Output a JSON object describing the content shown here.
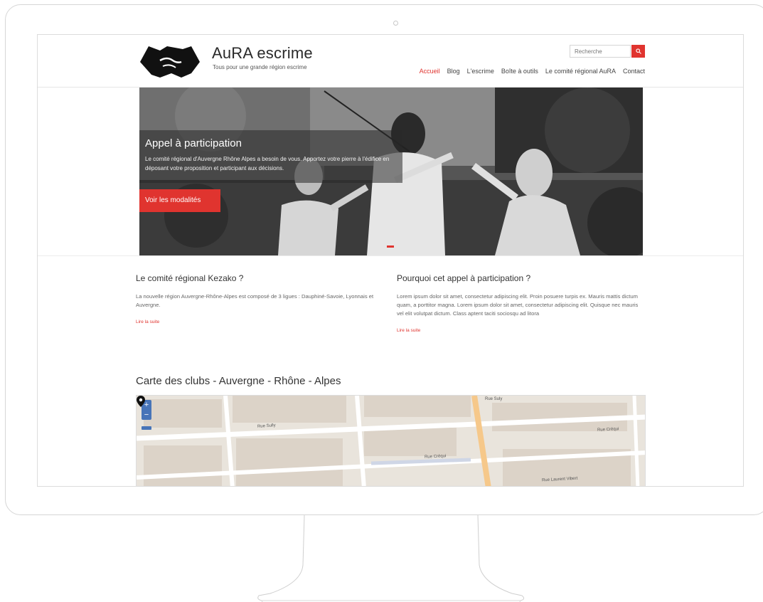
{
  "site": {
    "title": "AuRA escrime",
    "tagline": "Tous pour une grande région escrime"
  },
  "search": {
    "placeholder": "Recherche"
  },
  "nav": {
    "items": [
      "Accueil",
      "Blog",
      "L'escrime",
      "Boîte à outils",
      "Le comité régional AuRA",
      "Contact"
    ],
    "active": "Accueil"
  },
  "hero": {
    "title": "Appel à participation",
    "text": "Le comité régional d'Auvergne Rhône Alpes a besoin de vous. Apportez votre pierre à l'édifice en déposant votre proposition et participant aux décisions.",
    "button": "Voir les modalités"
  },
  "columns": [
    {
      "title": "Le comité régional Kezako ?",
      "text": "La nouvelle région Auvergne-Rhône-Alpes est composé de 3 ligues : Dauphiné-Savoie, Lyonnais et Auvergne.",
      "link": "Lire la suite"
    },
    {
      "title": "Pourquoi cet appel à participation ?",
      "text": "Lorem ipsum dolor sit amet, consectetur adipiscing elit. Proin posuere turpis ex. Mauris mattis dictum quam, a porttitor magna. Lorem ipsum dolor sit amet, consectetur adipiscing elit. Quisque nec mauris vel elit volutpat dictum. Class aptent taciti sociosqu ad litora",
      "link": "Lire la suite"
    }
  ],
  "map": {
    "title": "Carte des clubs - Auvergne - Rhône - Alpes",
    "zoom_in": "+",
    "zoom_out": "−",
    "streets": [
      "Rue Sully",
      "Rue Créqui",
      "Rue Créqui",
      "Rue Laurent Vibert",
      "Rue Suly"
    ],
    "colors": {
      "road": "#ffffff",
      "block": "#dcd3c8",
      "main_road": "#f6c88a"
    }
  },
  "colors": {
    "accent": "#e0342f"
  }
}
